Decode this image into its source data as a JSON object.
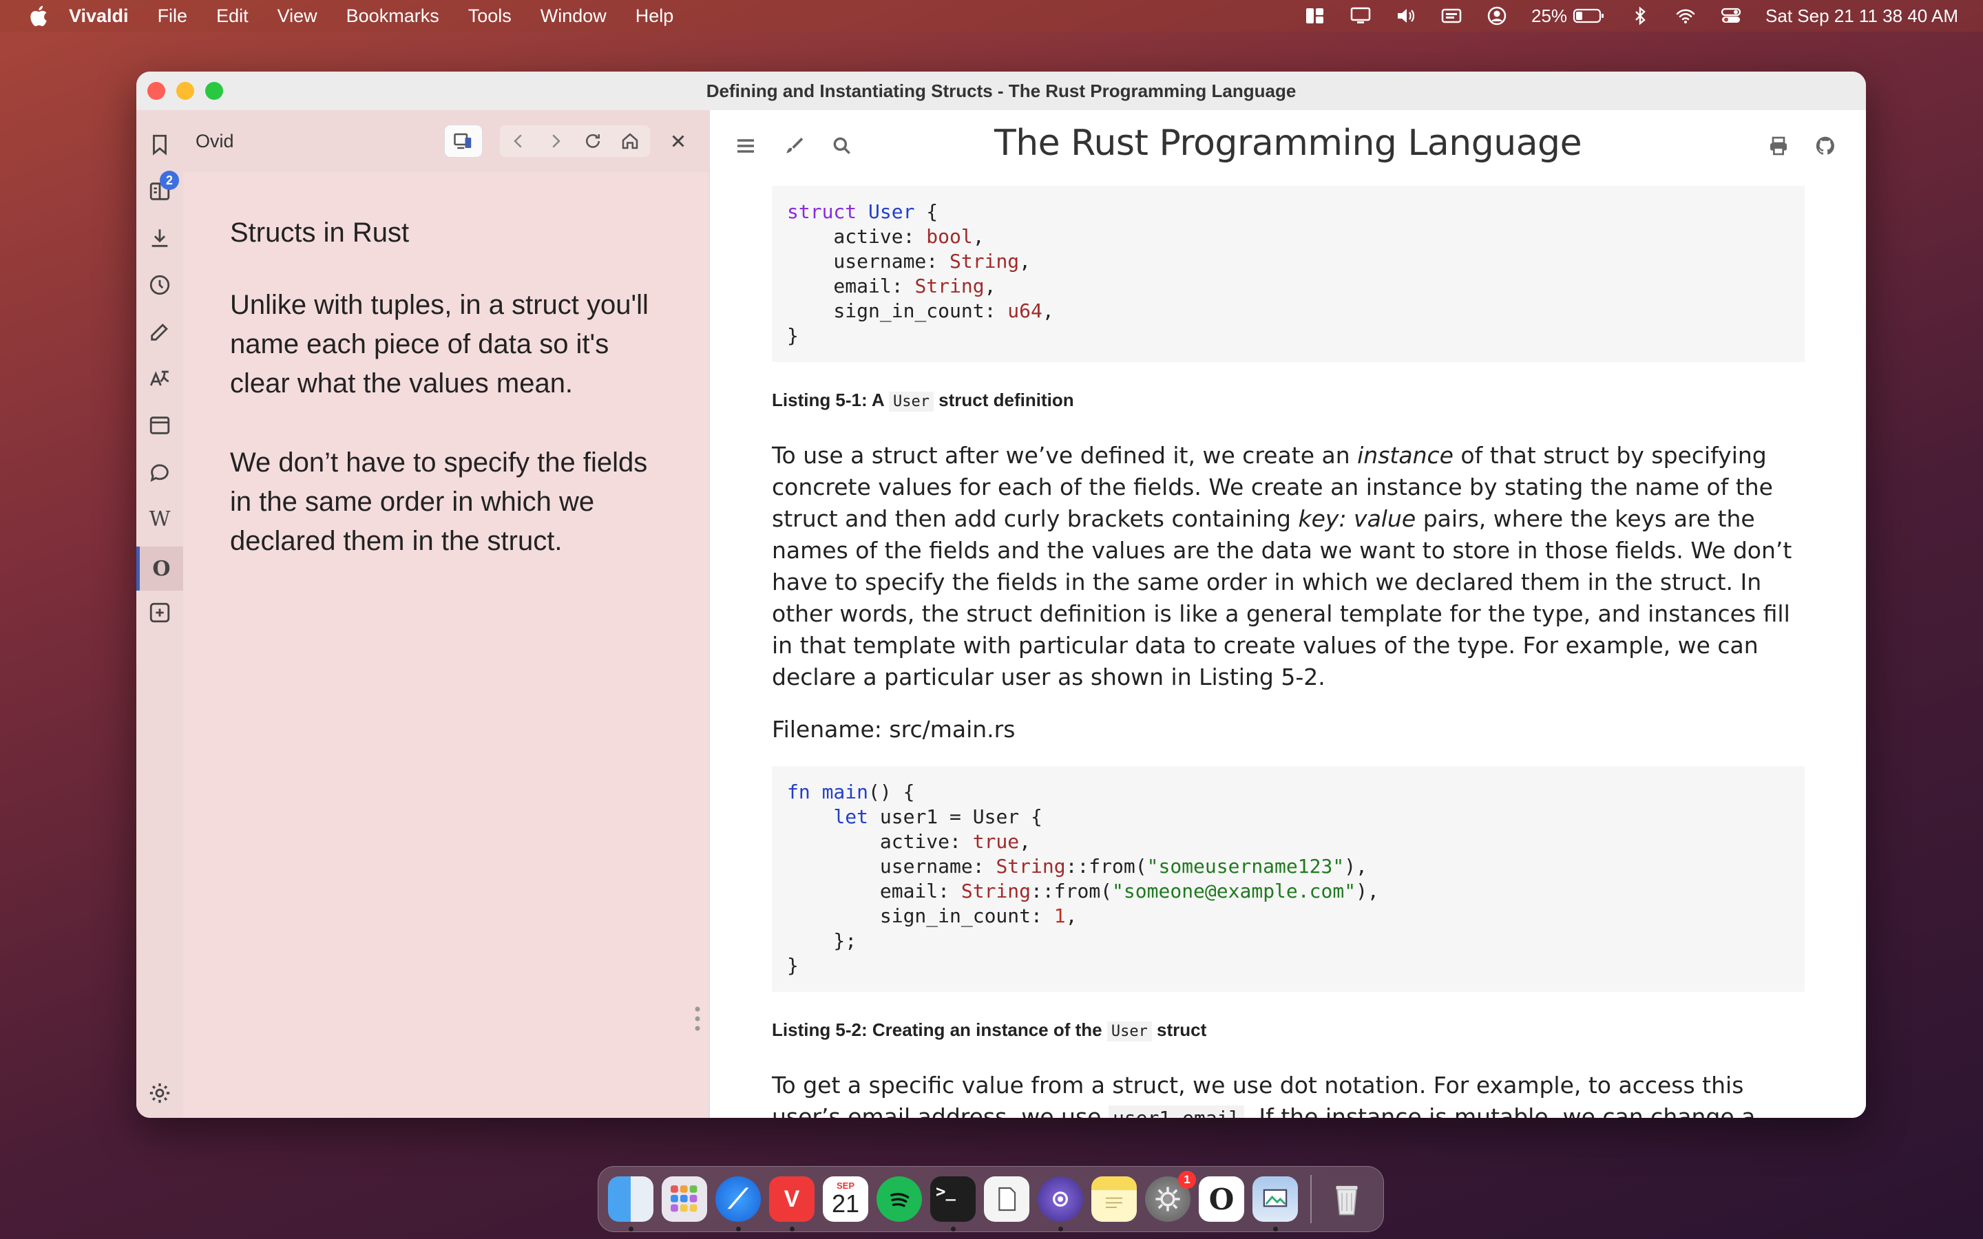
{
  "menubar": {
    "app_name": "Vivaldi",
    "items": [
      "File",
      "Edit",
      "View",
      "Bookmarks",
      "Tools",
      "Window",
      "Help"
    ],
    "battery_percent": "25%",
    "datetime": "Sat Sep 21  11 38 40 AM"
  },
  "window": {
    "title": "Defining and Instantiating Structs - The Rust Programming Language"
  },
  "panel_bar": {
    "items": [
      {
        "icon": "bookmark-icon"
      },
      {
        "icon": "reading-list-icon",
        "badge": "2"
      },
      {
        "icon": "download-icon"
      },
      {
        "icon": "history-icon"
      },
      {
        "icon": "notes-icon"
      },
      {
        "icon": "translate-icon"
      },
      {
        "icon": "window-icon"
      },
      {
        "icon": "chat-icon"
      },
      {
        "icon": "wikipedia-icon",
        "glyph": "W"
      },
      {
        "icon": "ovid-icon",
        "glyph": "O",
        "active": true
      },
      {
        "icon": "add-panel-icon"
      }
    ],
    "settings_icon": "gear-icon"
  },
  "web_panel": {
    "title": "Ovid",
    "content": {
      "heading": "Structs in Rust",
      "p1": "Unlike with tuples, in a struct you'll name each piece of data so it's clear what the values mean.",
      "p2": "We don’t have to specify the fields in the same order in which we declared them in the struct."
    }
  },
  "book": {
    "title": "The Rust Programming Language",
    "listing1": {
      "caption_prefix": "Listing 5-1: A ",
      "caption_code": "User",
      "caption_suffix": " struct definition"
    },
    "para1": {
      "t1": "To use a struct after we’ve defined it, we create an ",
      "em1": "instance",
      "t2": " of that struct by specifying concrete values for each of the fields. We create an instance by stating the name of the struct and then add curly brackets containing ",
      "em2": "key: value",
      "t3": " pairs, where the keys are the names of the fields and the values are the data we want to store in those fields. We don’t have to specify the fields in the same order in which we declared them in the struct. In other words, the struct definition is like a general template for the type, and instances fill in that template with particular data to create values of the type. For example, we can declare a particular user as shown in Listing 5-2."
    },
    "filename": "Filename: src/main.rs",
    "listing2": {
      "caption_prefix": "Listing 5-2: Creating an instance of the ",
      "caption_code": "User",
      "caption_suffix": " struct"
    },
    "para2": {
      "t1": "To get a specific value from a struct, we use dot notation. For example, to access this user’s email address, we use ",
      "code": "user1.email",
      "t2": ". If the instance is mutable, we can change a value by using the dot"
    }
  },
  "dock": {
    "apps": [
      "Finder",
      "Launchpad",
      "Safari",
      "Vivaldi",
      "Calendar",
      "Spotify",
      "Terminal",
      "Preview",
      "Screenshot",
      "Notes",
      "System Settings",
      "Ovid",
      "Preview Image",
      "Trash"
    ],
    "calendar_month": "SEP",
    "calendar_day": "21",
    "settings_badge": "1"
  }
}
